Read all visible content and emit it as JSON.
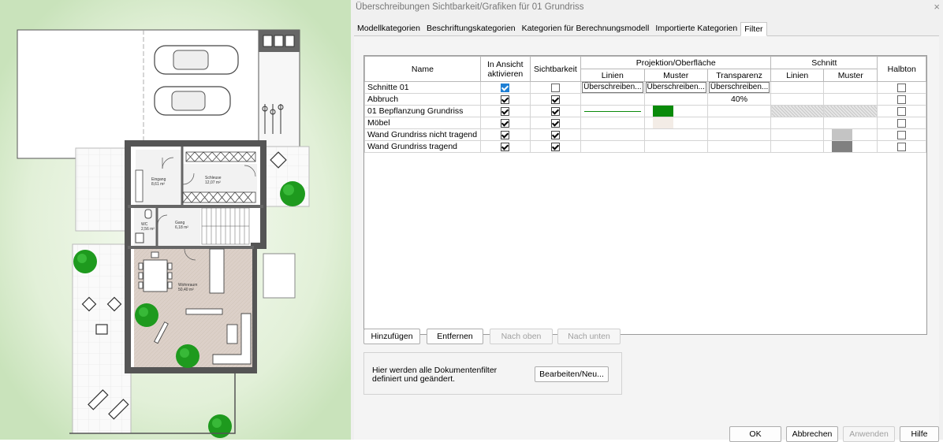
{
  "plan": {
    "rooms": [
      {
        "name": "Eingang",
        "area": "8,61 m²"
      },
      {
        "name": "Schleuse",
        "area": "12,07 m²"
      },
      {
        "name": "Gang",
        "area": "6,18 m²"
      },
      {
        "name": "WC",
        "area": "2,56 m²"
      },
      {
        "name": "Wohnraum",
        "area": "50,40 m²"
      }
    ]
  },
  "dialog": {
    "title": "Überschreibungen Sichtbarkeit/Grafiken für 01 Grundriss",
    "close_glyph": "×",
    "tabs": [
      "Modellkategorien",
      "Beschriftungskategorien",
      "Kategorien für Berechnungsmodell",
      "Importierte Kategorien",
      "Filter"
    ],
    "active_tab": "Filter",
    "table": {
      "headers": {
        "name": "Name",
        "enable": "In Ansicht aktivieren",
        "visibility": "Sichtbarkeit",
        "projection": "Projektion/Oberfläche",
        "cut": "Schnitt",
        "halftone": "Halbton",
        "lines": "Linien",
        "pattern": "Muster",
        "transparency": "Transparenz"
      },
      "rows": [
        {
          "name": "Schnitte 01",
          "enabled": true,
          "visible": false,
          "proj_lines": "Überschreiben...",
          "proj_pattern": "Überschreiben...",
          "transparency": "Überschreiben...",
          "cut_lines": "",
          "cut_pattern": "",
          "halftone": false
        },
        {
          "name": "Abbruch",
          "enabled": true,
          "visible": true,
          "proj_lines": "",
          "proj_pattern": "",
          "transparency": "40%",
          "cut_lines": "",
          "cut_pattern": "",
          "halftone": false
        },
        {
          "name": "01 Bepflanzung Grundriss",
          "enabled": true,
          "visible": true,
          "proj_lines": "",
          "proj_pattern": "",
          "transparency": "",
          "cut_lines": "",
          "cut_pattern": "",
          "halftone": false
        },
        {
          "name": "Möbel",
          "enabled": true,
          "visible": true,
          "proj_lines": "",
          "proj_pattern": "",
          "transparency": "",
          "cut_lines": "",
          "cut_pattern": "",
          "halftone": false
        },
        {
          "name": "Wand Grundriss nicht tragend",
          "enabled": true,
          "visible": true,
          "proj_lines": "",
          "proj_pattern": "",
          "transparency": "",
          "cut_lines": "",
          "cut_pattern": "",
          "halftone": false
        },
        {
          "name": "Wand Grundriss tragend",
          "enabled": true,
          "visible": true,
          "proj_lines": "",
          "proj_pattern": "",
          "transparency": "",
          "cut_lines": "",
          "cut_pattern": "",
          "halftone": false
        }
      ],
      "swatch_colors": {
        "green_line": "#0a8a0a",
        "green_fill": "#0a8a0a",
        "moebel_fill": "#f3ece6",
        "light_grey": "#c4c4c4",
        "dark_grey": "#808080"
      }
    },
    "buttons": {
      "add": "Hinzufügen",
      "remove": "Entfernen",
      "up": "Nach oben",
      "down": "Nach unten",
      "edit": "Bearbeiten/Neu..."
    },
    "info_text": "Hier werden alle Dokumentenfilter\ndefiniert und geändert.",
    "footer": {
      "ok": "OK",
      "cancel": "Abbrechen",
      "apply": "Anwenden",
      "help": "Hilfe"
    }
  }
}
